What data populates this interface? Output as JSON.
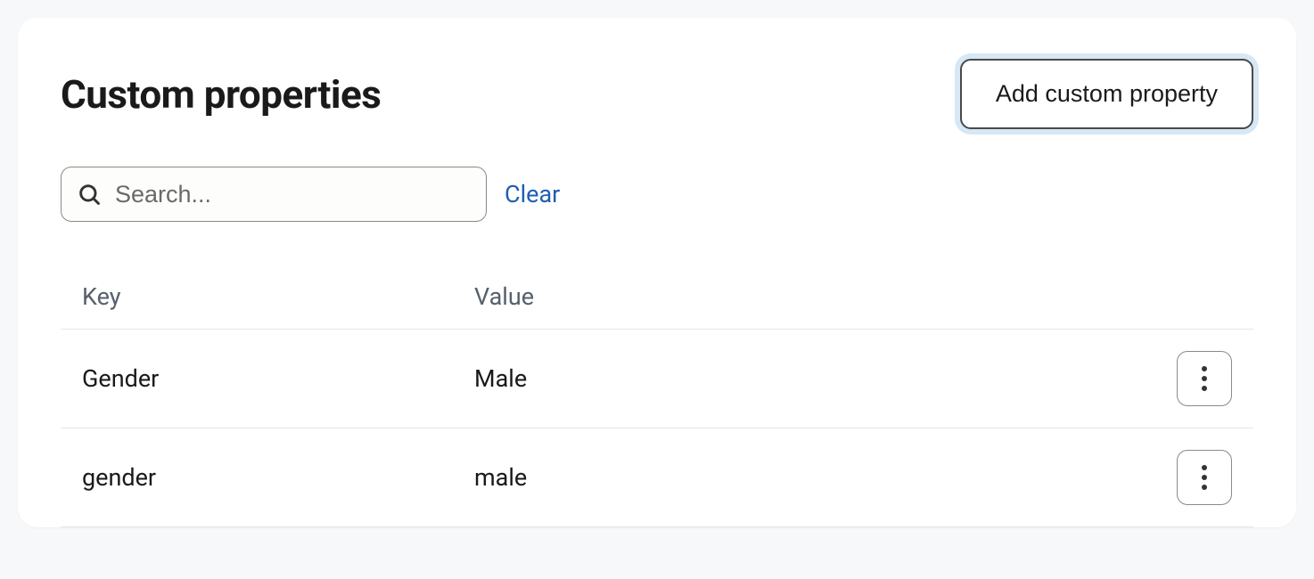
{
  "header": {
    "title": "Custom properties",
    "add_button_label": "Add custom property"
  },
  "search": {
    "placeholder": "Search...",
    "value": "",
    "clear_label": "Clear"
  },
  "table": {
    "columns": {
      "key": "Key",
      "value": "Value"
    },
    "rows": [
      {
        "key": "Gender",
        "value": "Male"
      },
      {
        "key": "gender",
        "value": "male"
      }
    ]
  }
}
